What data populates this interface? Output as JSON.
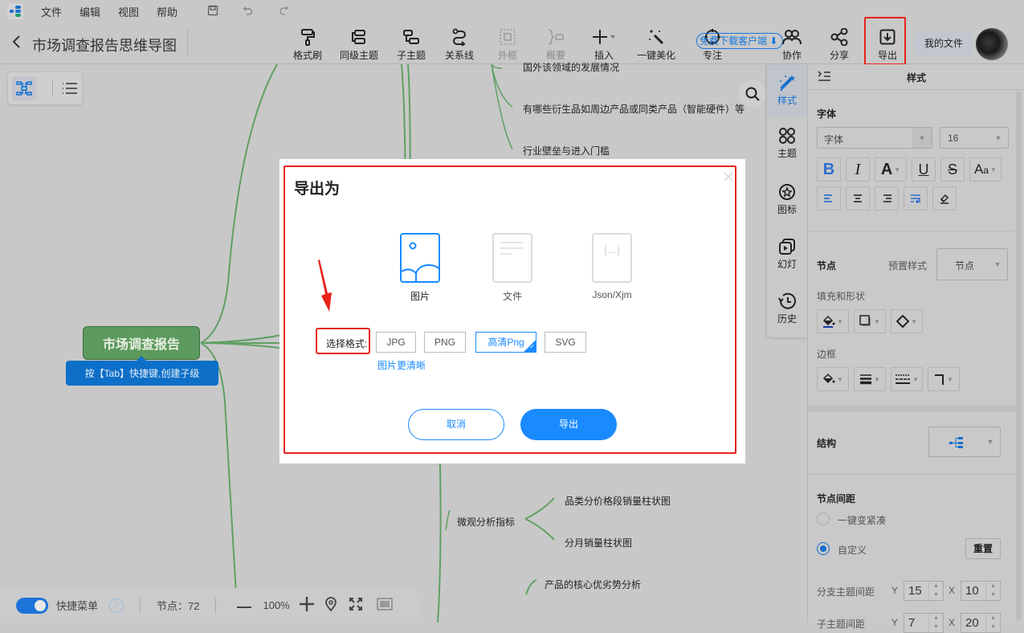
{
  "menubar": {
    "items": [
      "文件",
      "编辑",
      "视图",
      "帮助"
    ],
    "icons": [
      "save-icon",
      "undo-icon",
      "redo-icon"
    ]
  },
  "header": {
    "back_icon": "chevron-left-icon",
    "title": "市场调查报告思维导图"
  },
  "toolbar": {
    "tools": [
      {
        "label": "格式刷",
        "icon": "paint-roller-icon",
        "disabled": false
      },
      {
        "label": "同级主题",
        "icon": "sibling-topic-icon",
        "disabled": false
      },
      {
        "label": "子主题",
        "icon": "child-topic-icon",
        "disabled": false
      },
      {
        "label": "关系线",
        "icon": "relation-line-icon",
        "disabled": false
      },
      {
        "label": "外框",
        "icon": "boundary-icon",
        "disabled": true
      },
      {
        "label": "概要",
        "icon": "summary-icon",
        "disabled": true
      },
      {
        "label": "插入",
        "icon": "plus-icon",
        "disabled": false
      },
      {
        "label": "一键美化",
        "icon": "magic-wand-icon",
        "disabled": false
      },
      {
        "label": "专注",
        "icon": "focus-icon",
        "disabled": false
      },
      {
        "label": "协作",
        "icon": "users-icon",
        "disabled": false
      },
      {
        "label": "分享",
        "icon": "share-icon",
        "disabled": false
      },
      {
        "label": "导出",
        "icon": "export-icon",
        "disabled": false
      }
    ],
    "download_client": "免费下载客户端",
    "my_files": "我的文件"
  },
  "canvas": {
    "root": "市场调查报告",
    "tab_tip": "按【Tab】快捷键,创建子级",
    "nodes": [
      "国外该领域的发展情况",
      "有哪些衍生品如周边产品或同类产品（智能硬件）等",
      "行业壁垒与进入门槛",
      "微观分析指标",
      "品类分价格段销量柱状图",
      "分月销量柱状图",
      "产品的核心优劣势分析"
    ]
  },
  "statusbar": {
    "quick_menu_label": "快捷菜单",
    "quick_menu_on": true,
    "node_count_label": "节点：72",
    "zoom": "100%"
  },
  "side_tabs": [
    {
      "label": "样式",
      "icon": "style-wand-icon",
      "active": true
    },
    {
      "label": "主题",
      "icon": "theme-grid-icon",
      "active": false
    },
    {
      "label": "图标",
      "icon": "sticker-icon",
      "active": false
    },
    {
      "label": "幻灯",
      "icon": "slides-icon",
      "active": false
    },
    {
      "label": "历史",
      "icon": "history-icon",
      "active": false
    }
  ],
  "panel": {
    "title": "样式",
    "font_section": "字体",
    "font_family_value": "字体",
    "font_size_value": "16",
    "node_section": "节点",
    "preset_style_label": "预置样式",
    "preset_style_value": "节点",
    "fill_shape_label": "填充和形状",
    "border_label": "边框",
    "structure_label": "结构",
    "spacing_section": "节点间距",
    "compact_label": "一键变紧凑",
    "custom_label": "自定义",
    "spacing_mode": "自定义",
    "reset_label": "重置",
    "branch_spacing_label": "分支主题间距",
    "branch_y": "15",
    "branch_x": "10",
    "sub_spacing_label": "子主题间距",
    "sub_y": "7",
    "sub_x": "20",
    "y_label": "Y",
    "x_label": "X"
  },
  "modal": {
    "title": "导出为",
    "file_types": [
      {
        "label": "图片",
        "icon": "image-file-icon",
        "active": true
      },
      {
        "label": "文件",
        "icon": "document-file-icon",
        "active": false
      },
      {
        "label": "Json/Xjm",
        "icon": "json-file-icon",
        "active": false
      }
    ],
    "format_label": "选择格式:",
    "formats": [
      {
        "label": "JPG",
        "selected": false
      },
      {
        "label": "PNG",
        "selected": false
      },
      {
        "label": "高清Png",
        "selected": true
      },
      {
        "label": "SVG",
        "selected": false
      }
    ],
    "format_hint": "图片更清晰",
    "cancel": "取消",
    "export": "导出"
  },
  "colors": {
    "accent": "#1a8aff",
    "annotation_red": "#e8231b",
    "root_node": "#5d9a5f",
    "branch_line": "#5fa063",
    "tip_blue": "#0d6fc8"
  }
}
